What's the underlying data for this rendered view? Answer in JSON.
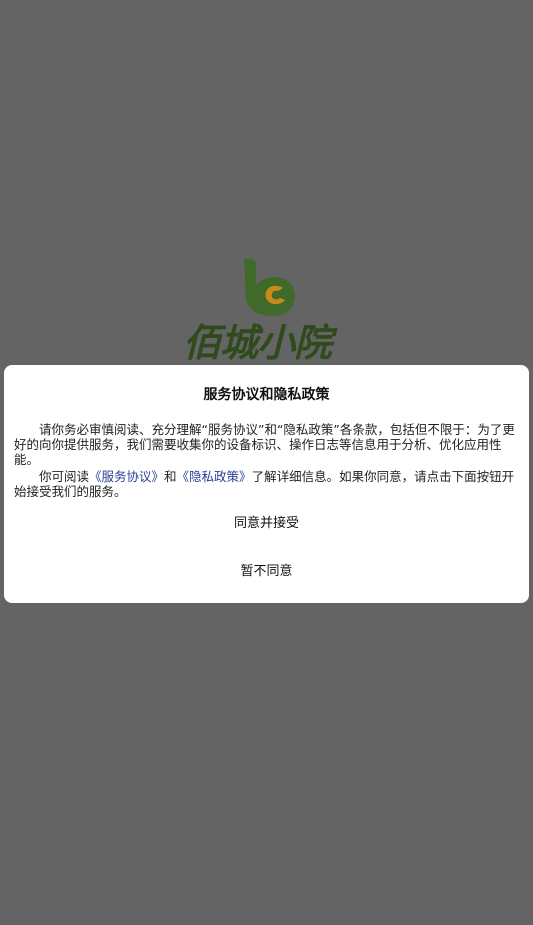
{
  "app": {
    "logo_text": "佰城小院",
    "colors": {
      "overlay": "#646464",
      "logo_green": "#3f6a2a",
      "logo_orange": "#c98a1a",
      "link": "#2a3f9a"
    }
  },
  "dialog": {
    "title": "服务协议和隐私政策",
    "paragraph1": "请你务必审慎阅读、充分理解“服务协议”和“隐私政策”各条款，包括但不限于：为了更好的向你提供服务，我们需要收集你的设备标识、操作日志等信息用于分析、优化应用性能。",
    "paragraph2_prefix": "你可阅读",
    "service_link": "《服务协议》",
    "and_text": "和",
    "privacy_link": "《隐私政策》",
    "paragraph2_suffix": "了解详细信息。如果你同意，请点击下面按钮开始接受我们的服务。",
    "agree_button": "同意并接受",
    "decline_button": "暂不同意"
  }
}
